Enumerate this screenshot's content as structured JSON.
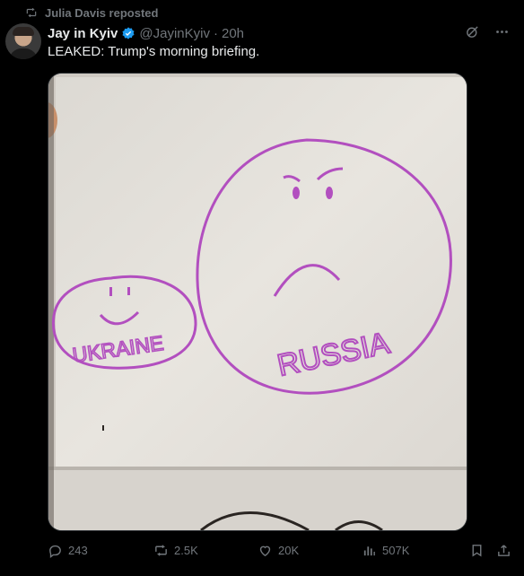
{
  "repost": {
    "text": "Julia Davis reposted",
    "icon": "repost-icon"
  },
  "author": {
    "name": "Jay in Kyiv",
    "handle": "@JayinKyiv",
    "separator": "·",
    "time": "20h",
    "verified": true
  },
  "tweet": {
    "text": "LEAKED: Trump's morning briefing."
  },
  "image": {
    "alt_labels": {
      "left_circle": "UKRAINE",
      "right_circle": "RUSSIA"
    },
    "colors": {
      "ink": "#b24fbf",
      "paper": "#e7e4de"
    }
  },
  "actions": {
    "replies": "243",
    "reposts": "2.5K",
    "likes": "20K",
    "views": "507K"
  },
  "colors": {
    "background": "#000000",
    "text": "#e7e9ea",
    "muted": "#71767b",
    "verified": "#1d9bf0"
  }
}
